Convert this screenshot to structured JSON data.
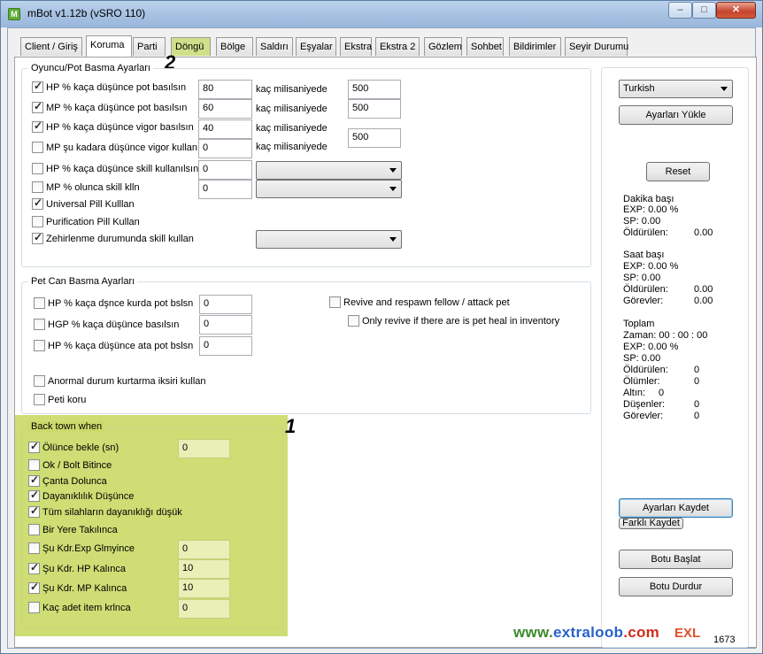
{
  "window": {
    "title": "mBot v1.12b (vSRO 110)",
    "icon": "M",
    "min": "‒",
    "max": "□",
    "close": "✕"
  },
  "tabs": [
    {
      "label": "Client / Giriş"
    },
    {
      "label": "Koruma"
    },
    {
      "label": "Parti"
    },
    {
      "label": "Döngü"
    },
    {
      "label": "Bölge"
    },
    {
      "label": "Saldırı"
    },
    {
      "label": "Eşyalar"
    },
    {
      "label": "Ekstra"
    },
    {
      "label": "Ekstra 2"
    },
    {
      "label": "Gözlem"
    },
    {
      "label": "Sohbet"
    },
    {
      "label": "Bildirimler"
    },
    {
      "label": "Seyir Durumu"
    }
  ],
  "annotations": {
    "one": "1",
    "two": "2"
  },
  "pot": {
    "title": "Oyuncu/Pot Basma Ayarları",
    "rows": [
      {
        "label": "HP % kaça düşünce pot basılsın",
        "checked": true,
        "value": "80",
        "ms_label": "kaç milisaniyede",
        "ms": "500"
      },
      {
        "label": "MP % kaça düşünce pot basılsın",
        "checked": true,
        "value": "60",
        "ms_label": "kaç milisaniyede",
        "ms": "500"
      },
      {
        "label": "HP % kaça düşünce vigor basılsın",
        "checked": true,
        "value": "40",
        "ms_label": "kaç milisaniyede",
        "ms": "500"
      },
      {
        "label": "MP şu kadara düşünce vigor kullan",
        "checked": false,
        "value": "0",
        "ms_label": "kaç milisaniyede"
      },
      {
        "label": "HP % kaça düşünce skill kullanılsın",
        "checked": false,
        "value": "0"
      },
      {
        "label": "MP % olunca skill klln",
        "checked": false,
        "value": "0"
      },
      {
        "label": "Universal Pill Kulllan",
        "checked": true
      },
      {
        "label": "Purification Pill Kullan",
        "checked": false
      },
      {
        "label": "Zehirlenme durumunda skill kullan",
        "checked": true
      }
    ]
  },
  "pet": {
    "title": "Pet Can Basma Ayarları",
    "rows": [
      {
        "label": "HP % kaça dşnce kurda pot bslsn",
        "checked": false,
        "value": "0"
      },
      {
        "label": "HGP % kaça düşünce basılsın",
        "checked": false,
        "value": "0"
      },
      {
        "label": "HP % kaça düşünce ata pot bslsn",
        "checked": false,
        "value": "0"
      },
      {
        "label": "Anormal durum kurtarma iksiri kullan",
        "checked": false
      },
      {
        "label": "Peti koru",
        "checked": false
      }
    ],
    "revive": {
      "label": "Revive and respawn fellow / attack pet",
      "checked": false
    },
    "only_revive": {
      "label": "Only revive if there are is pet heal in inventory",
      "checked": false
    }
  },
  "backtown": {
    "title": "Back town when",
    "rows": [
      {
        "label": "Ölünce bekle (sn)",
        "checked": true,
        "value": "0"
      },
      {
        "label": "Ok / Bolt Bitince",
        "checked": false
      },
      {
        "label": "Çanta Dolunca",
        "checked": true
      },
      {
        "label": "Dayanıklılık Düşünce",
        "checked": true
      },
      {
        "label": "Tüm silahların dayanıklığı düşük",
        "checked": true
      },
      {
        "label": "Bir Yere Takılınca",
        "checked": false
      },
      {
        "label": "Şu Kdr.Exp Glmyince",
        "checked": false,
        "value": "0"
      },
      {
        "label": "Şu Kdr. HP Kalınca",
        "checked": true,
        "value": "10"
      },
      {
        "label": "Şu Kdr. MP Kalınca",
        "checked": true,
        "value": "10"
      },
      {
        "label": "Kaç adet item krlnca",
        "checked": false,
        "value": "0"
      }
    ]
  },
  "side": {
    "language": "Turkish",
    "load_btn": "Ayarları Yükle",
    "reset_btn": "Reset",
    "per_min": {
      "title": "Dakika başı",
      "exp": "EXP:      0.00 %",
      "sp": "SP:        0.00",
      "kills_label": "Öldürülen:",
      "kills": "0.00"
    },
    "per_hour": {
      "title": "Saat başı",
      "exp": "EXP:      0.00 %",
      "sp": "SP:        0.00",
      "kills_label": "Öldürülen:",
      "kills": "0.00",
      "quests_label": "Görevler:",
      "quests": "0.00"
    },
    "total": {
      "title": "Toplam",
      "time": "Zaman: 00 : 00 : 00",
      "exp": "EXP:      0.00 %",
      "sp": "SP:        0.00",
      "kills_label": "Öldürülen:",
      "kills": "0",
      "deaths_label": "Ölümler:",
      "deaths": "0",
      "gold_label": "Altın:",
      "gold": "0",
      "drops_label": "Düşenler:",
      "drops": "0",
      "quests_label": "Görevler:",
      "quests": "0"
    },
    "save_btn": "Ayarları Kaydet",
    "save_as_btn": "Farklı Kaydet",
    "start_btn": "Botu Başlat",
    "stop_btn": "Botu Durdur",
    "counter": "1673"
  },
  "watermark": {
    "www": "www.",
    "name": "extraloob",
    "dom": ".com",
    "mark": "EXL"
  },
  "colors": {
    "highlight": "#bcd046",
    "title_bar": "#a7c2e2"
  }
}
